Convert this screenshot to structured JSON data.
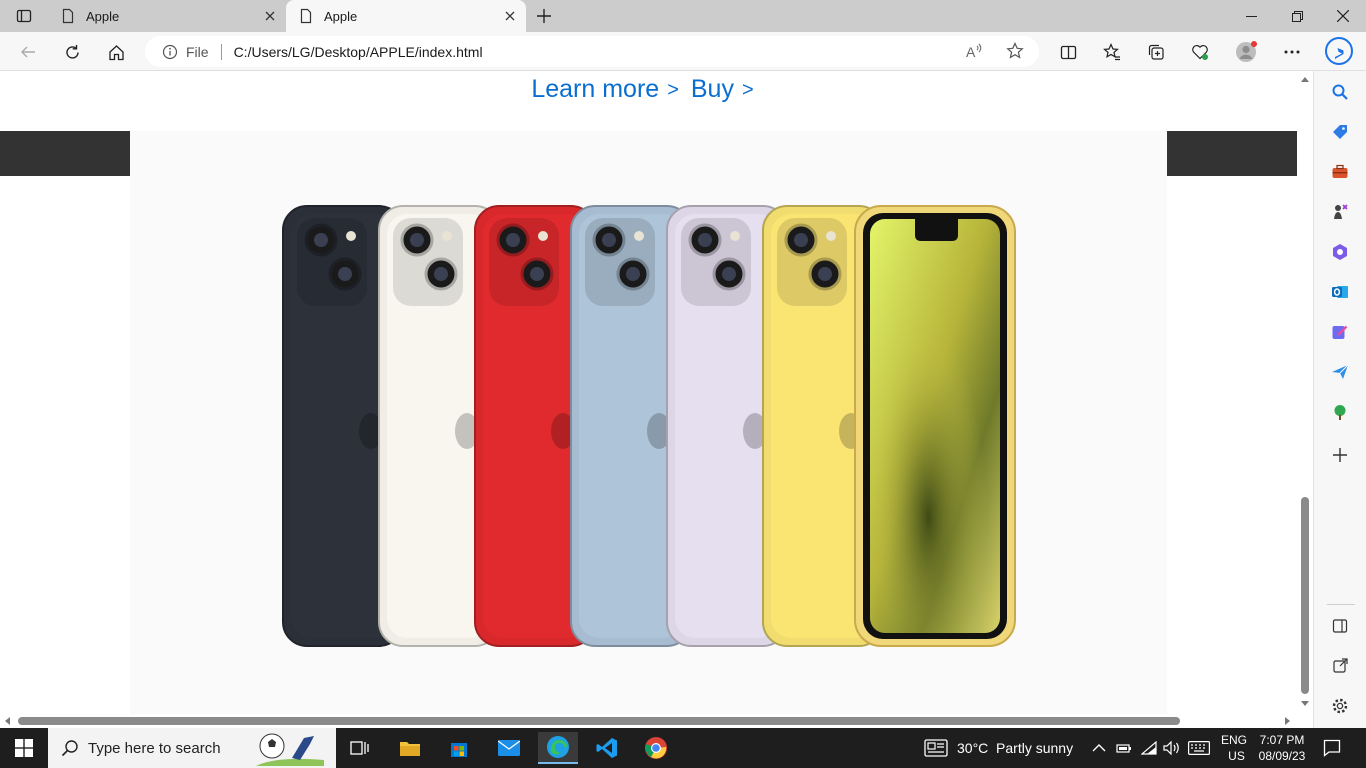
{
  "browser": {
    "tabs": [
      {
        "label": "Apple",
        "active": false
      },
      {
        "label": "Apple",
        "active": true
      }
    ],
    "address": {
      "protocol_label": "File",
      "url": "C:/Users/LG/Desktop/APPLE/index.html"
    }
  },
  "page": {
    "links": {
      "learn_more": "Learn more",
      "buy": "Buy",
      "chevron": ">"
    },
    "hero_image": "iphone-14-lineup",
    "phone_colors": [
      "#2a2f38",
      "#efede6",
      "#d8282c",
      "#a7bcd0",
      "#ddd6e6",
      "#f0dc6f"
    ]
  },
  "taskbar": {
    "search_placeholder": "Type here to search",
    "weather": "30°C  Partly sunny",
    "language": {
      "line1": "ENG",
      "line2": "US"
    },
    "clock": {
      "time": "7:07 PM",
      "date": "08/09/23"
    }
  },
  "colors": {
    "link": "#0a6ed1",
    "band": "#333333",
    "taskbar": "#1e1e1e"
  }
}
